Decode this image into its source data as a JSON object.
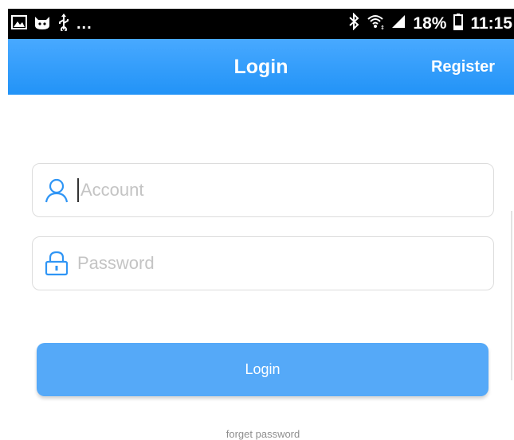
{
  "status_bar": {
    "icons_left": [
      "image-icon",
      "cat-icon",
      "usb-icon"
    ],
    "overflow": "...",
    "battery": "18%",
    "time": "11:15",
    "icons_right": [
      "bluetooth-icon",
      "wifi-icon",
      "signal-icon",
      "battery-icon"
    ]
  },
  "header": {
    "title": "Login",
    "register": "Register",
    "colors": {
      "top": "#48a9ff",
      "bottom": "#2293f7"
    }
  },
  "form": {
    "account_placeholder": "Account",
    "account_value": "",
    "password_placeholder": "Password",
    "password_value": "",
    "login_button": "Login",
    "forget_password": "forget password"
  },
  "colors": {
    "accent": "#2f95f5",
    "button": "#55a9f8",
    "placeholder": "#c4c4c4"
  }
}
